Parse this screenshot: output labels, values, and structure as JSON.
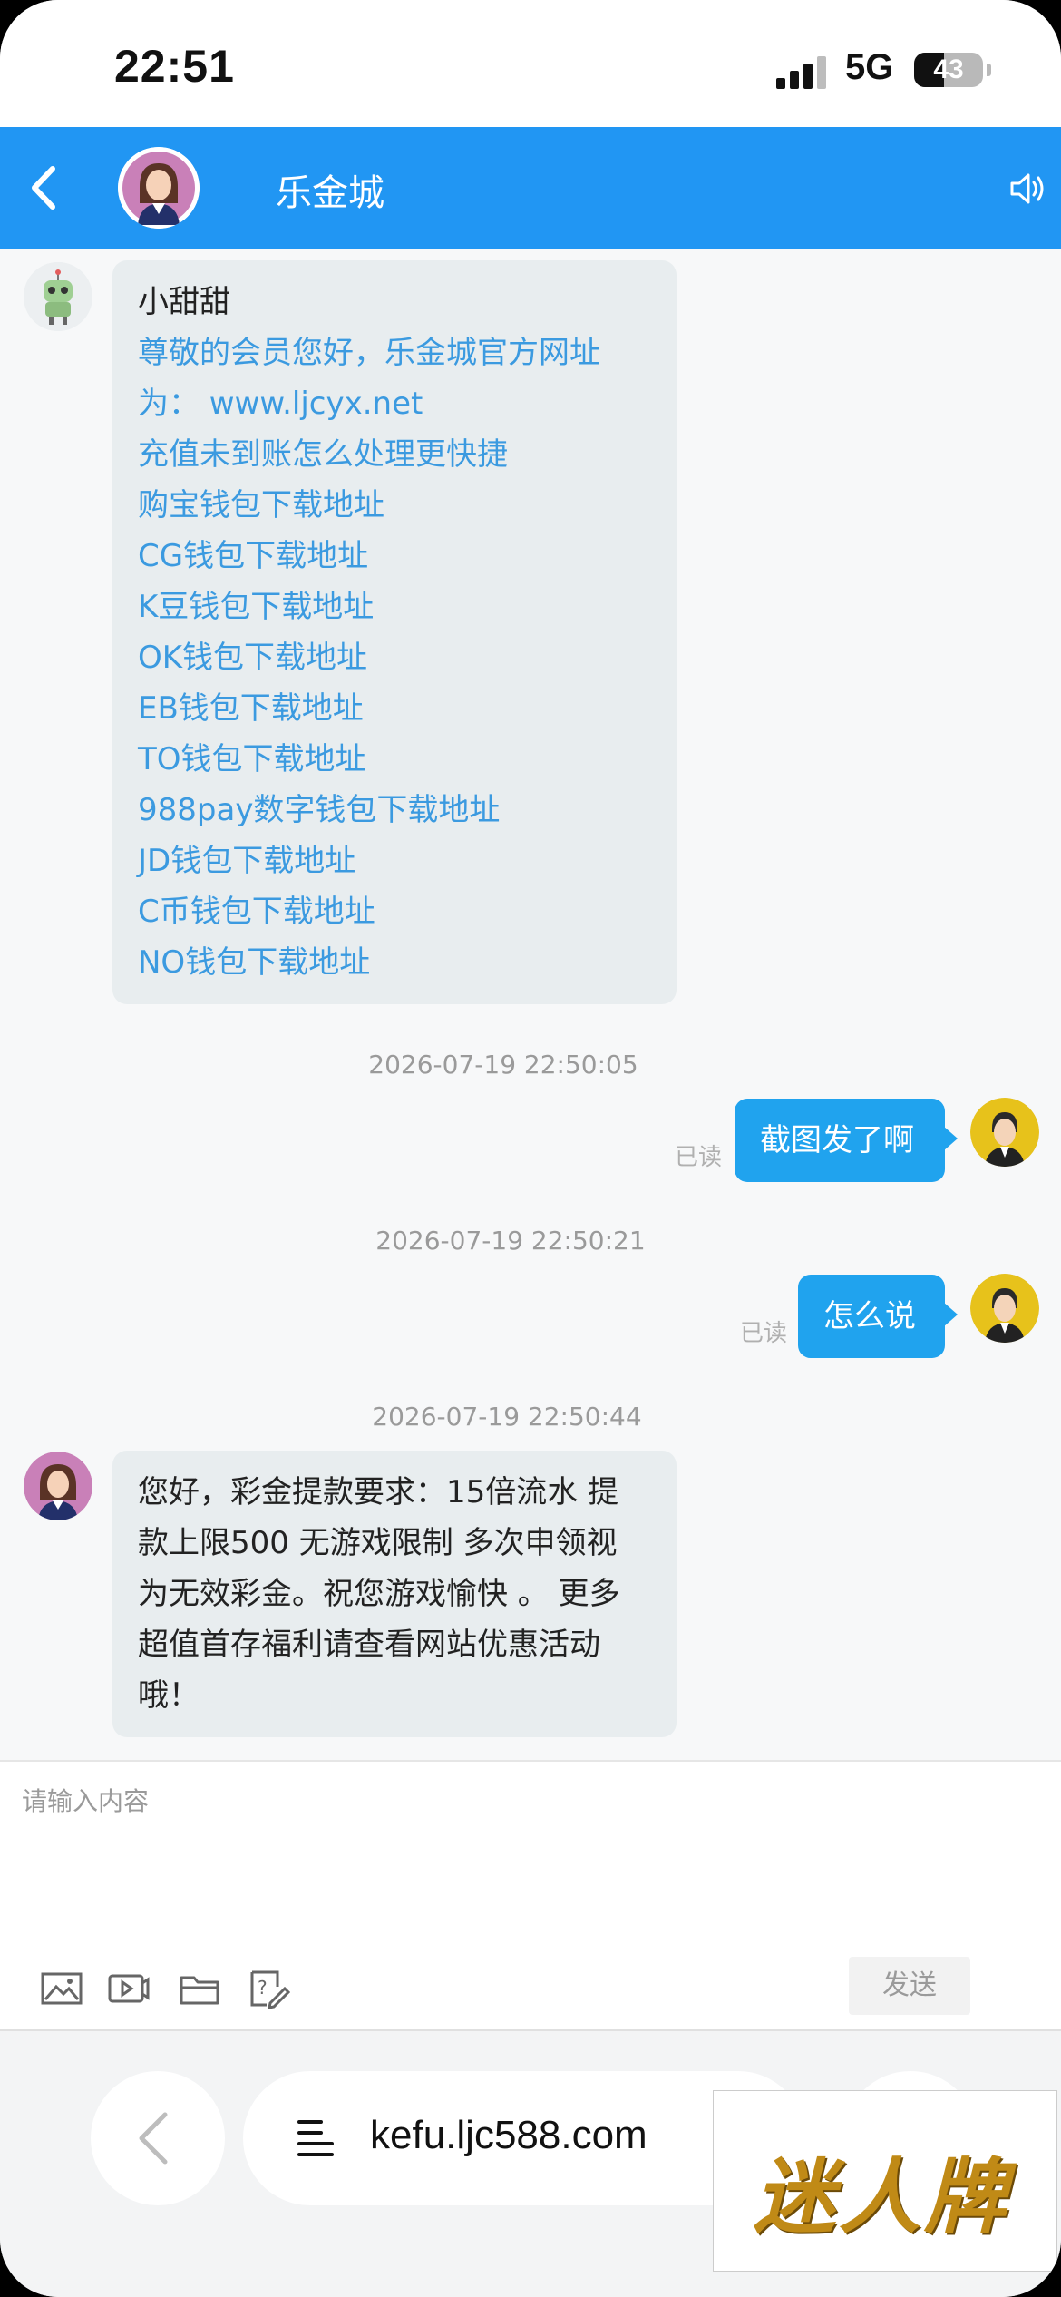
{
  "status_bar": {
    "time": "22:51",
    "network": "5G",
    "battery": "43",
    "battery_level": 0.43
  },
  "header": {
    "title": "乐金城"
  },
  "messages": {
    "bot": {
      "name": "小甜甜",
      "links": [
        "尊敬的会员您好，乐金城官方网址",
        "为：  www.ljcyx.net",
        "充值未到账怎么处理更快捷",
        "购宝钱包下载地址",
        "CG钱包下载地址",
        "K豆钱包下载地址",
        "OK钱包下载地址",
        "EB钱包下载地址",
        "TO钱包下载地址",
        "988pay数字钱包下载地址",
        "JD钱包下载地址",
        "C币钱包下载地址",
        "NO钱包下载地址"
      ]
    },
    "ts1": "2026-07-19 22:50:05",
    "out1": {
      "text": "截图发了啊",
      "status": "已读"
    },
    "ts2": "2026-07-19 22:50:21",
    "out2": {
      "text": "怎么说",
      "status": "已读"
    },
    "ts3": "2026-07-19 22:50:44",
    "agent": {
      "lines": [
        "您好，彩金提款要求：15倍流水 提",
        "款上限500 无游戏限制 多次申领视",
        "为无效彩金。祝您游戏愉快 。 更多",
        "超值首存福利请查看网站优惠活动",
        "哦！"
      ]
    }
  },
  "composer": {
    "placeholder": "请输入内容",
    "send_label": "发送"
  },
  "browser": {
    "url": "kefu.ljc588.com"
  },
  "watermark": {
    "text": "迷人牌"
  },
  "colors": {
    "header": "#2196f3",
    "link": "#3b9ae0",
    "out_bubble": "#20a3ee"
  }
}
